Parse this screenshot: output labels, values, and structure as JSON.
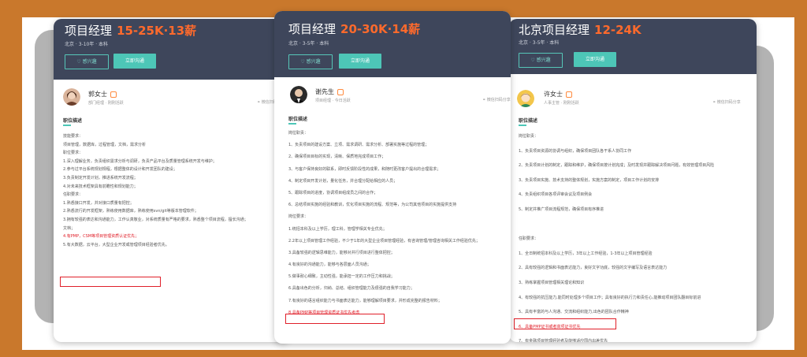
{
  "cards": [
    {
      "title": "项目经理",
      "salary": "15-25K·13薪",
      "meta": "北京 · 3-10年 · 本科",
      "follow": "♡ 感兴趣",
      "chat": "立即沟通",
      "recruiter": "郭女士",
      "recruiter_role": "部门经理 · 刚刚活跃",
      "share": "微信扫码分享",
      "section": "职位描述",
      "lines": [
        "技能要求：",
        "项目管理，数据库，过程管理，文档，需求分析",
        "职位要求：",
        "1.深入理解业务，负责组织需求分析与调研，负责产品平台及质量管理系统开发与维护；",
        "2.参与过平台系统规划规程，根据整体的设计和开发团队的建设；",
        "3.负责制定开发计划，推进系统开发流程；",
        "4.对未来技术框架具有前瞻性和规划能力；",
        "任职要求：",
        "1.熟悉接口开发，并对接口质量有把控；",
        "2.熟悉流行的开发框架，熟练使用数据库，熟练使用svn/git等版本管理软件；",
        "3.拥有较强的表达和沟通能力，工作认真敬业，对系统质量有严格的要求，熟悉整个项目流程，擅长沟通；",
        "文档；",
        "4.有PMP，CSM等项目管理资质认证优先；",
        "5.有大数据，云平台，大型企业开发或管理项目经验者优先。"
      ]
    },
    {
      "title": "项目经理",
      "salary": "20-30K·14薪",
      "meta": "北京 · 3-5年 · 本科",
      "follow": "♡ 感兴趣",
      "chat": "立即沟通",
      "recruiter": "谢先生",
      "recruiter_role": "项目经理 · 今日活跃",
      "share": "微信扫码分享",
      "section": "职位描述",
      "lines": [
        "岗位职责：",
        "1、负责项目的建设方案、立项、需求调研、需求分析、部署实施等过程的管理；",
        "2、确保项目目标的实现，清晰、保质地完成项目工作；",
        "3、与客户保持良好的联系，即时反馈阶段性的成果，和随时更改客户提出的合理需求；",
        "4、制定项目开发计划，量化任务，并合理分配给相应的人员；",
        "5、跟踪项目的进度，协调项目组成员之间的合作；",
        "6、总结项目实施的经验和教训，优化项目实施的流程、规范等，为公司其他项目的实施提供支持",
        "岗位要求：",
        "1.统招本科及以上学历，理工科，管理学相关专业优先；",
        "2.2年以上项目管理工作经验，不少于1年的大型企业项目管理经验，有咨询管理/管理咨询相关工作经验优先；",
        "3.具备较强的逻辑思维能力，能够对并行项目进行整体把控；",
        "4.有良好的沟通能力，能够与各层面人员沟通；",
        "5.做事耐心细致，主动性强，能承担一定的工作压力和挑战；",
        "6.具备出色的分析，归纳、总结、组织管理能力及很强的自我学习能力；",
        "7.有良好的语言组织能力与书面表达能力，能够理解项目要求，并形成完整的报告材料；",
        "8.具备PMP等项目管理资质证书优先考虑"
      ]
    },
    {
      "title": "北京项目经理",
      "salary": "12-24K",
      "meta": "北京 · 3-5年 · 本科",
      "follow": "♡ 感兴趣",
      "chat": "立即沟通",
      "recruiter": "许女士",
      "recruiter_role": "人事主管 · 刚刚活跃",
      "share": "微信扫码分享",
      "section": "职位描述",
      "lines": [
        "岗位职责：",
        "1、负责项目资源的协调与组织，确保项目团队各干系人协同工作",
        "2、负责项目计划的制定，跟踪和维护，确保项目按计划完成；及时发现并跟踪解决项目问题，有效管理项目风险",
        "3、负责项目实施、技术支持的整体规划，实施方案的制定，项目工作计划的安排",
        "4、负责组织项目各项评审会议及项目例会",
        "5、制定并推广项目流程规范，确保项目有序推进",
        "",
        "任职要求：",
        "1、全日制统招本科及以上学历，3年以上工作经验，1-3年以上项目管理经验",
        "2、具有较强的逻辑和书面表达能力，良好文字功底，较强的文字编写及语言表达能力",
        "3、熟练掌握项目管理相关理论和知识",
        "4、有较强的抗压能力,能同时处理多个项目工作；具有良好的执行力和责任心,能推动项目团队翻目标前进",
        "5、具有丰富的与人沟通、交流和组织能力,出色的团队合作精神",
        "6、具备PMP证书或者高项证书优先",
        "7、有金融项目管理经验者及能够适应国内出差优先"
      ]
    }
  ]
}
